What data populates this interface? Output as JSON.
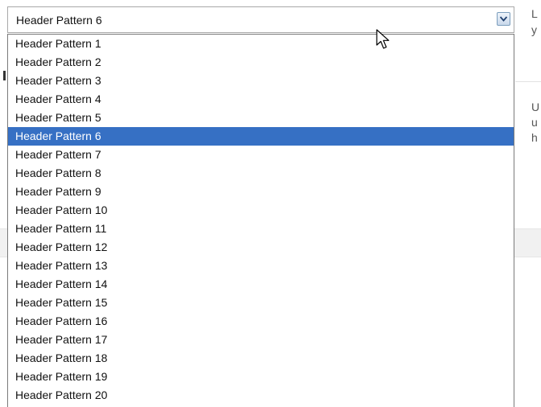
{
  "select": {
    "value": "Header Pattern 6",
    "arrow_icon": "chevron-down-icon"
  },
  "options": [
    "Header Pattern 1",
    "Header Pattern 2",
    "Header Pattern 3",
    "Header Pattern 4",
    "Header Pattern 5",
    "Header Pattern 6",
    "Header Pattern 7",
    "Header Pattern 8",
    "Header Pattern 9",
    "Header Pattern 10",
    "Header Pattern 11",
    "Header Pattern 12",
    "Header Pattern 13",
    "Header Pattern 14",
    "Header Pattern 15",
    "Header Pattern 16",
    "Header Pattern 17",
    "Header Pattern 18",
    "Header Pattern 19",
    "Header Pattern 20"
  ],
  "selected_index": 5,
  "side_text": {
    "line1": "L",
    "line2": "y",
    "line3": "U",
    "line4": "u",
    "line5": "h"
  },
  "colors": {
    "selected_bg": "#3670c4",
    "selected_fg": "#ffffff"
  }
}
